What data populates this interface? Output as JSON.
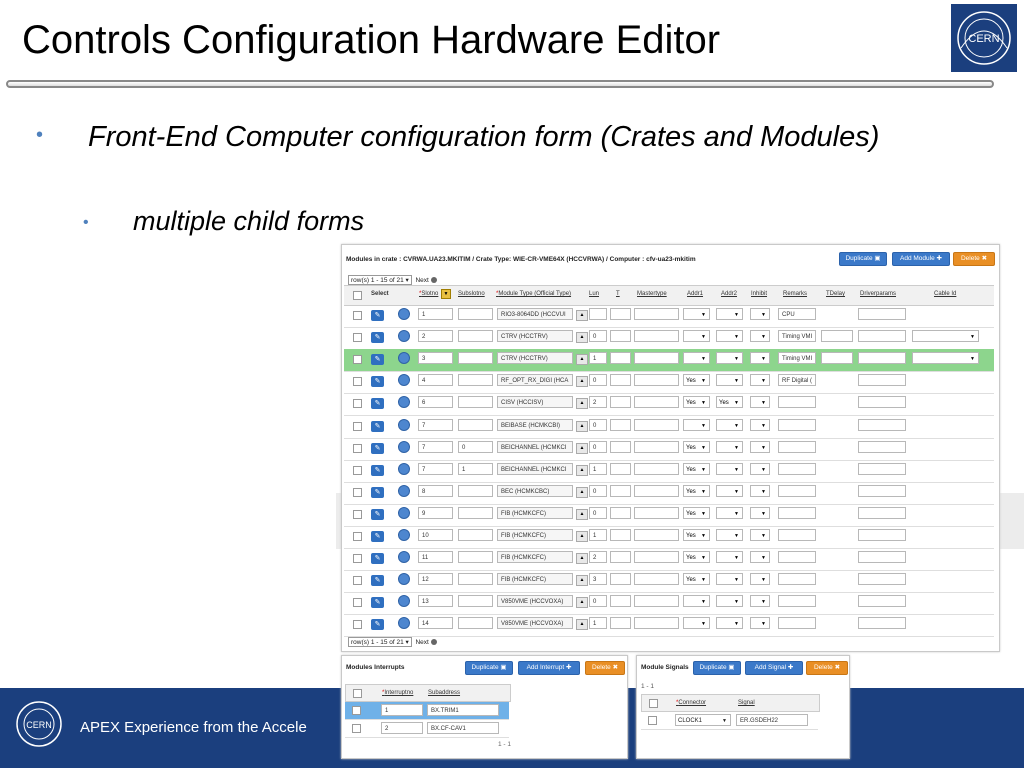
{
  "slide": {
    "title": "Controls Configuration Hardware Editor",
    "bullet1": "Front-End Computer configuration form (Crates and Modules)",
    "bullet2": "multiple child forms",
    "footer_text": "APEX Experience from the Accele",
    "logo_text": "CERN"
  },
  "modules_panel": {
    "header": "Modules in crate : CVRWA.UA23.MKITIM / Crate Type: WIE-CR-VME64X (HCCVRWA) / Computer : cfv-ua23-mkitim",
    "duplicate_label": "Duplicate",
    "add_label": "Add Module",
    "delete_label": "Delete",
    "pager_label": "row(s) 1 - 15 of 21",
    "next_label": "Next",
    "columns": [
      "Select",
      "Slotno",
      "Subslotno",
      "Module Type (Official Type)",
      "Lun",
      "T",
      "Mastertype",
      "Addr1",
      "Addr2",
      "Inhibit",
      "Remarks",
      "TDelay",
      "Driverparams",
      "Cable Id"
    ],
    "rows": [
      {
        "slot": "1",
        "sub": "",
        "type": "RIO3-8064DD (HCCVUI",
        "lun": "",
        "addr1": "",
        "addr2": "",
        "remarks": "CPU",
        "cable": false
      },
      {
        "slot": "2",
        "sub": "",
        "type": "CTRV (HCCTRV)",
        "lun": "0",
        "addr1": "",
        "addr2": "",
        "remarks": "Timing VMI",
        "cable": true
      },
      {
        "slot": "3",
        "sub": "",
        "type": "CTRV (HCCTRV)",
        "lun": "1",
        "addr1": "",
        "addr2": "",
        "remarks": "Timing VMI",
        "cable": true
      },
      {
        "slot": "4",
        "sub": "",
        "type": "RF_OPT_RX_DIGI (HCA",
        "lun": "0",
        "addr1": "Yes",
        "addr2": "",
        "remarks": "RF Digital (",
        "cable": false
      },
      {
        "slot": "6",
        "sub": "",
        "type": "CISV (HCCISV)",
        "lun": "2",
        "addr1": "Yes",
        "addr2": "Yes",
        "remarks": "",
        "cable": false
      },
      {
        "slot": "7",
        "sub": "",
        "type": "BEIBASE (HCMKCBI)",
        "lun": "0",
        "addr1": "",
        "addr2": "",
        "remarks": "",
        "cable": false
      },
      {
        "slot": "7",
        "sub": "0",
        "type": "BEICHANNEL (HCMKCI",
        "lun": "0",
        "addr1": "Yes",
        "addr2": "",
        "remarks": "",
        "cable": false
      },
      {
        "slot": "7",
        "sub": "1",
        "type": "BEICHANNEL (HCMKCI",
        "lun": "1",
        "addr1": "Yes",
        "addr2": "",
        "remarks": "",
        "cable": false
      },
      {
        "slot": "8",
        "sub": "",
        "type": "BEC (HCMKCBC)",
        "lun": "0",
        "addr1": "Yes",
        "addr2": "",
        "remarks": "",
        "cable": false
      },
      {
        "slot": "9",
        "sub": "",
        "type": "FIB (HCMKCFC)",
        "lun": "0",
        "addr1": "Yes",
        "addr2": "",
        "remarks": "",
        "cable": false
      },
      {
        "slot": "10",
        "sub": "",
        "type": "FIB (HCMKCFC)",
        "lun": "1",
        "addr1": "Yes",
        "addr2": "",
        "remarks": "",
        "cable": false
      },
      {
        "slot": "11",
        "sub": "",
        "type": "FIB (HCMKCFC)",
        "lun": "2",
        "addr1": "Yes",
        "addr2": "",
        "remarks": "",
        "cable": false
      },
      {
        "slot": "12",
        "sub": "",
        "type": "FIB (HCMKCFC)",
        "lun": "3",
        "addr1": "Yes",
        "addr2": "",
        "remarks": "",
        "cable": false
      },
      {
        "slot": "13",
        "sub": "",
        "type": "V850VME (HCCVOXA)",
        "lun": "0",
        "addr1": "",
        "addr2": "",
        "remarks": "",
        "cable": false
      },
      {
        "slot": "14",
        "sub": "",
        "type": "V850VME (HCCVOXA)",
        "lun": "1",
        "addr1": "",
        "addr2": "",
        "remarks": "",
        "cable": false
      }
    ],
    "highlighted_row": 2
  },
  "interrupts_panel": {
    "header": "Modules Interrupts",
    "duplicate_label": "Duplicate",
    "add_label": "Add Interrupt",
    "delete_label": "Delete",
    "columns": [
      "Interruptno",
      "Subaddress"
    ],
    "rows": [
      {
        "no": "1",
        "sub": "BX.TRIM1"
      },
      {
        "no": "2",
        "sub": "BX.CF-CAV1"
      }
    ],
    "pager": "1 - 1"
  },
  "signals_panel": {
    "header": "Module Signals",
    "duplicate_label": "Duplicate",
    "add_label": "Add Signal",
    "delete_label": "Delete",
    "pager": "1 - 1",
    "columns": [
      "Connector",
      "Signal"
    ],
    "rows": [
      {
        "connector": "CLOCK1",
        "signal": "ER.GSDEH22"
      }
    ]
  },
  "colors": {
    "footer": "#1b3f7e",
    "button_blue": "#3b79c9",
    "button_orange": "#e98f25",
    "row_highlight": "#8dd58d",
    "row_selected": "#6fb1e8"
  }
}
